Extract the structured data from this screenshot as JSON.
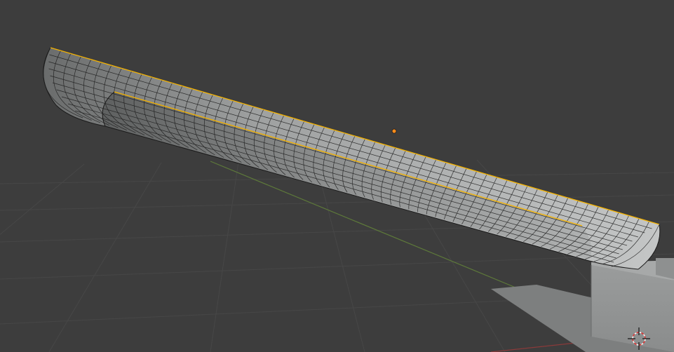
{
  "viewport": {
    "background_color": "#3d3d3d",
    "grid_color": "#4a4a4a",
    "x_axis_color": "#8a3a3a",
    "y_axis_color": "#5e7a3a"
  },
  "scene_objects": [
    {
      "name": "curved-trough-mesh",
      "selected": true,
      "wireframe_visible": true
    },
    {
      "name": "gray-box-object",
      "selected": false
    },
    {
      "name": "ground-plane-object",
      "selected": false
    }
  ],
  "selection": {
    "outline_color": "#f5b300",
    "origin_color": "#ff8c1a"
  },
  "mesh": {
    "face_color": "#b4b6b6",
    "wire_color": "#1a1a1a"
  },
  "icons": {
    "cursor": "3d-cursor-icon",
    "origin": "object-origin-icon"
  }
}
